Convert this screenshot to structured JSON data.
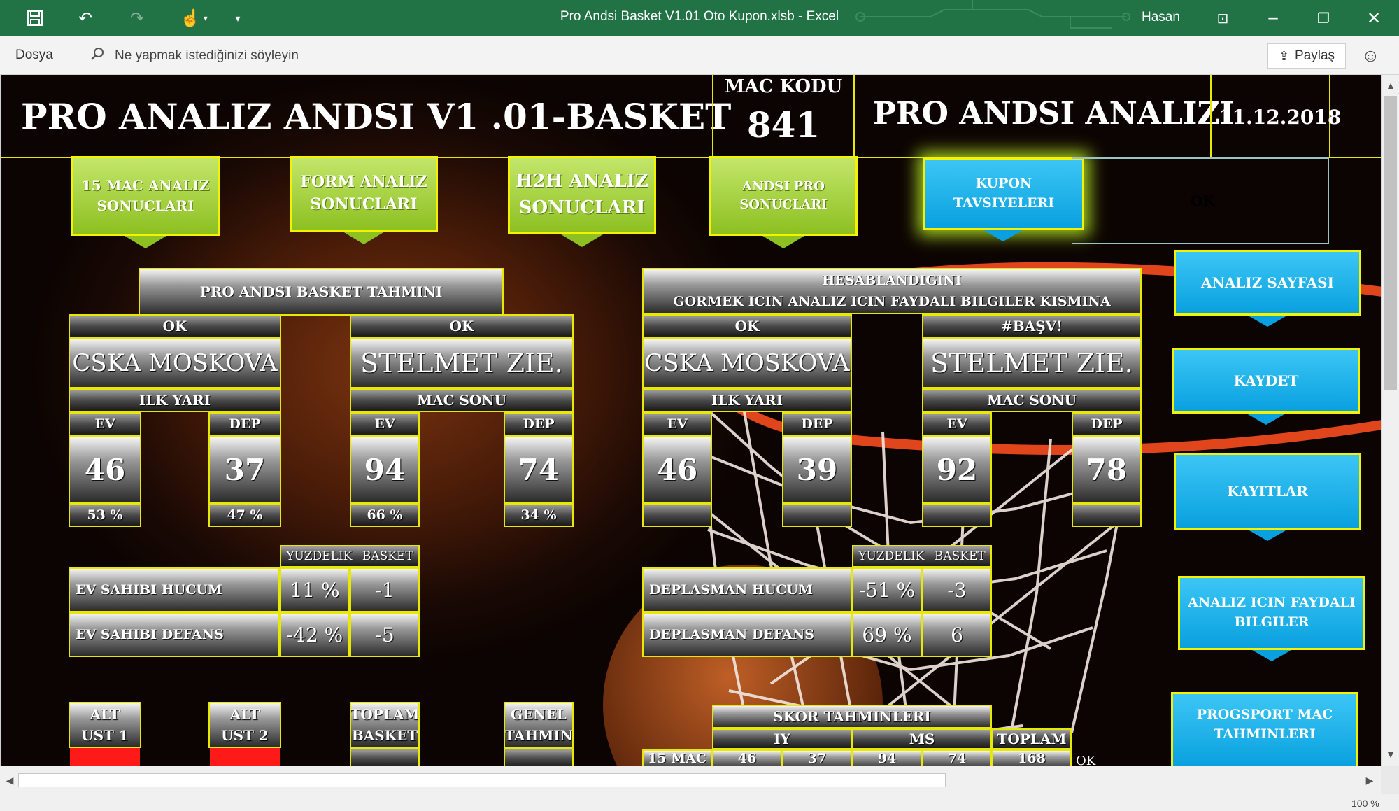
{
  "titlebar": {
    "doc_title": "Pro Andsi Basket V1.01 Oto Kupon.xlsb  -  Excel",
    "user": "Hasan",
    "icons": [
      "save-icon",
      "undo-icon",
      "redo-icon",
      "touch-mode-icon",
      "customize-icon",
      "ribbon-display-icon",
      "minimize-icon",
      "restore-icon",
      "close-icon"
    ]
  },
  "ribbon": {
    "file_tab": "Dosya",
    "tellme_placeholder": "Ne yapmak istediğinizi söyleyin",
    "share_label": "Paylaş"
  },
  "sheet": {
    "main_title": "PRO ANALIZ ANDSI  V1 .01-BASKET",
    "mac_kodu_label": "MAC KODU",
    "mac_kodu_value": "841",
    "sub_title": "PRO ANDSI ANALIZI",
    "date": "11.12.2018",
    "tabs": [
      {
        "label": "15 MAC ANALIZ\nSONUCLARI"
      },
      {
        "label": "FORM ANALIZ\nSONUCLARI"
      },
      {
        "label": "H2H ANALIZ\nSONUCLARI"
      },
      {
        "label": "ANDSI PRO\nSONUCLARI"
      },
      {
        "label": "KUPON\nTAVSIYELERI"
      }
    ],
    "ok_box": "OK",
    "side_buttons": [
      {
        "label": "ANALIZ SAYFASI"
      },
      {
        "label": "KAYDET"
      },
      {
        "label": "KAYITLAR"
      },
      {
        "label": "ANALIZ ICIN FAYDALI\nBILGILER"
      },
      {
        "label": "PROGSPORT MAC\nTAHMINLERI"
      }
    ],
    "left_panel": {
      "header": "PRO ANDSI  BASKET TAHMINI",
      "home": {
        "status": "OK",
        "team": "CSKA MOSKOVA",
        "period": "ILK YARI",
        "ev_label": "EV",
        "dep_label": "DEP",
        "ev_value": "46",
        "dep_value": "37",
        "ev_pct": "53 %",
        "dep_pct": "47 %"
      },
      "away": {
        "status": "OK",
        "team": "STELMET ZIE.",
        "period": "MAC SONU",
        "ev_label": "EV",
        "dep_label": "DEP",
        "ev_value": "94",
        "dep_value": "74",
        "ev_pct": "66 %",
        "dep_pct": "34 %"
      },
      "stats_header_1": "YUZDELIK",
      "stats_header_2": "BASKET",
      "stats": [
        {
          "label": "EV SAHIBI HUCUM",
          "pct": "11 %",
          "basket": "-1"
        },
        {
          "label": "EV SAHIBI DEFANS",
          "pct": "-42 %",
          "basket": "-5"
        }
      ],
      "bottom": [
        {
          "label": "ALT\nUST 1"
        },
        {
          "label": "ALT\nUST 2"
        },
        {
          "label": "TOPLAM\nBASKET"
        },
        {
          "label": "GENEL\nTAHMIN"
        }
      ]
    },
    "right_panel": {
      "header": "IDDIA  BUROSU ONGORULEN DEGERLER NASIL HESABLANDIGINI\nGORMEK ICIN ANALIZ ICIN FAYDALI BILGILER KISMINA BAKINIZ",
      "home": {
        "status": "OK",
        "team": "CSKA MOSKOVA",
        "period": "ILK YARI",
        "ev_label": "EV",
        "dep_label": "DEP",
        "ev_value": "46",
        "dep_value": "39"
      },
      "away": {
        "status": "#BAŞV!",
        "team": "STELMET ZIE.",
        "period": "MAC SONU",
        "ev_label": "EV",
        "dep_label": "DEP",
        "ev_value": "92",
        "dep_value": "78"
      },
      "stats_header_1": "YUZDELIK",
      "stats_header_2": "BASKET",
      "stats": [
        {
          "label": "DEPLASMAN HUCUM",
          "pct": "-51 %",
          "basket": "-3"
        },
        {
          "label": "DEPLASMAN DEFANS",
          "pct": "69 %",
          "basket": "6"
        }
      ],
      "skor_header": "SKOR TAHMINLERI",
      "skor_iy": "IY",
      "skor_ms": "MS",
      "skor_toplam": "TOPLAM",
      "skor_row": {
        "label": "15 MAC",
        "v1": "46",
        "v2": "37",
        "v3": "94",
        "v4": "74",
        "total": "168",
        "status": "OK"
      }
    }
  },
  "statusbar": {
    "zoom": "100 %"
  },
  "colors": {
    "excel_green": "#217346",
    "yellow_border": "#f3f300",
    "green_btn": "#8dc021",
    "blue_btn": "#09a0df",
    "red_alert": "#ff1a1a"
  }
}
